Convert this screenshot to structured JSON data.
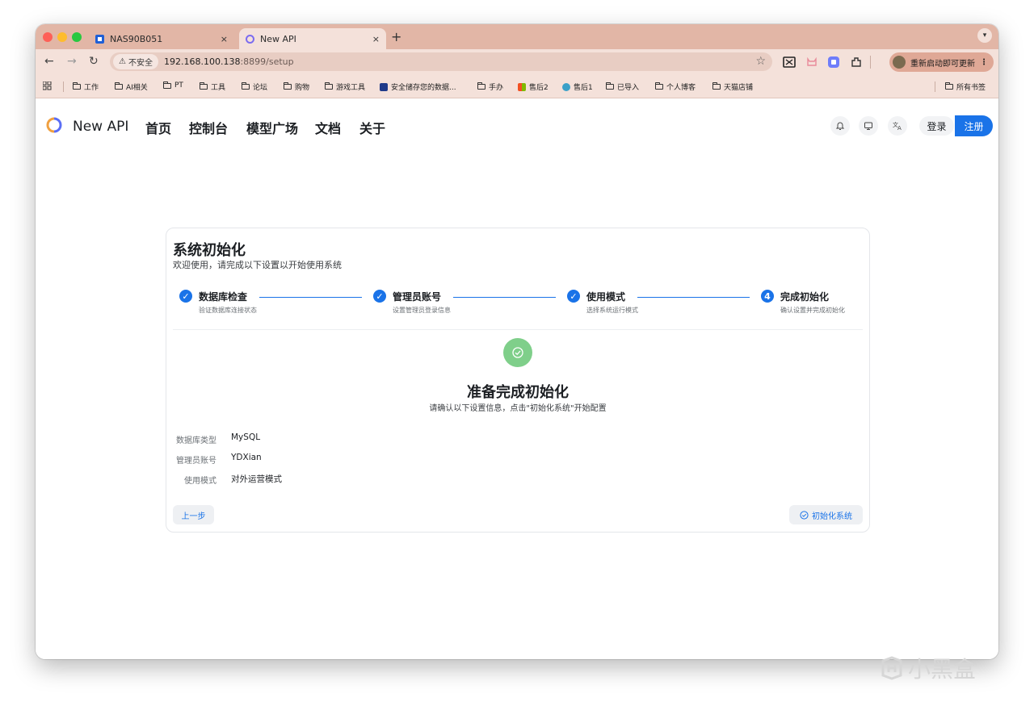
{
  "browser": {
    "tabs": [
      {
        "title": "NAS90B051",
        "active": false
      },
      {
        "title": "New API",
        "active": true
      }
    ],
    "new_tab": "+",
    "close_glyph": "×",
    "address": {
      "insecure_label": "不安全",
      "host": "192.168.100.138",
      "rest": ":8899/setup"
    },
    "update_label": "重新启动即可更新",
    "bookmarks": [
      "工作",
      "AI相关",
      "PT",
      "工具",
      "论坛",
      "购物",
      "游戏工具",
      "安全储存您的数据...",
      "手办",
      "售后2",
      "售后1",
      "已导入",
      "个人博客",
      "天猫店铺"
    ],
    "all_bookmarks": "所有书签"
  },
  "app": {
    "brand": "New API",
    "nav": [
      "首页",
      "控制台",
      "模型广场",
      "文档",
      "关于"
    ],
    "login": "登录",
    "register": "注册",
    "accent": "#1a73e8"
  },
  "setup": {
    "title": "系统初始化",
    "subtitle": "欢迎使用，请完成以下设置以开始使用系统",
    "steps": [
      {
        "label": "数据库检查",
        "desc": "验证数据库连接状态",
        "status": "done"
      },
      {
        "label": "管理员账号",
        "desc": "设置管理员登录信息",
        "status": "done"
      },
      {
        "label": "使用模式",
        "desc": "选择系统运行模式",
        "status": "done"
      },
      {
        "number": "4",
        "label": "完成初始化",
        "desc": "确认设置并完成初始化",
        "status": "current"
      }
    ],
    "ready_title": "准备完成初始化",
    "ready_subtitle": "请确认以下设置信息，点击\"初始化系统\"开始配置",
    "summary": [
      {
        "label": "数据库类型",
        "value": "MySQL"
      },
      {
        "label": "管理员账号",
        "value": "YDXian"
      },
      {
        "label": "使用模式",
        "value": "对外运营模式"
      }
    ],
    "prev_button": "上一步",
    "init_button": "初始化系统"
  },
  "watermark": "小黑盒"
}
